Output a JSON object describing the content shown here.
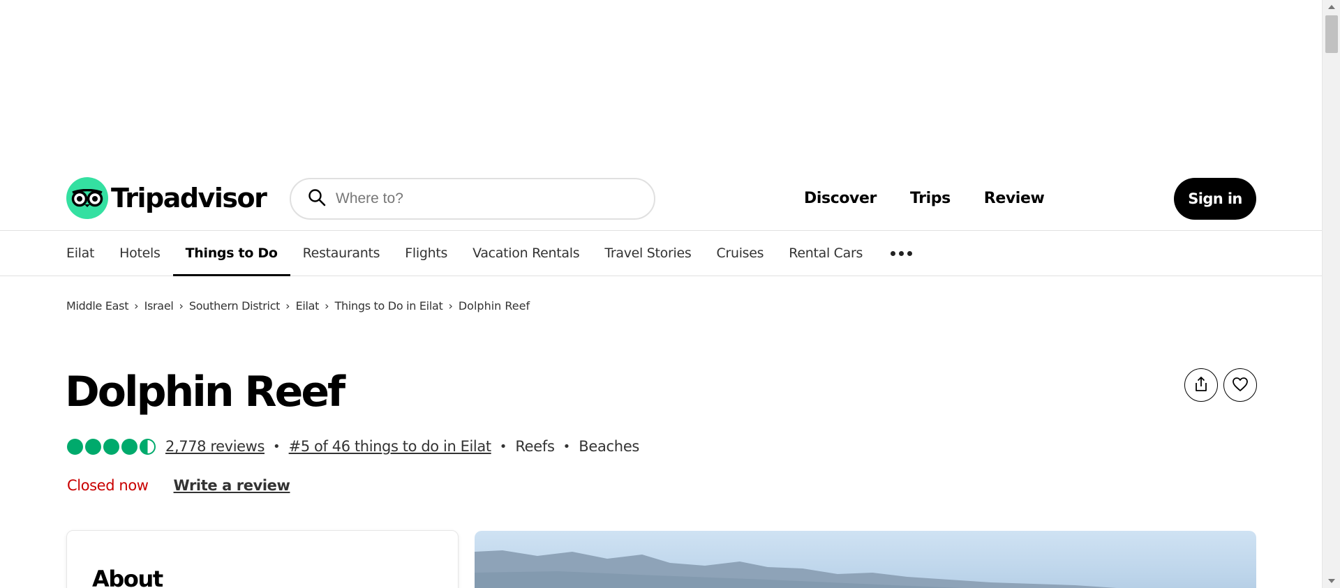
{
  "header": {
    "logo_text": "Tripadvisor",
    "search": {
      "placeholder": "Where to?"
    },
    "nav": [
      "Discover",
      "Trips",
      "Review"
    ],
    "signin_label": "Sign in"
  },
  "subnav": {
    "items": [
      "Eilat",
      "Hotels",
      "Things to Do",
      "Restaurants",
      "Flights",
      "Vacation Rentals",
      "Travel Stories",
      "Cruises",
      "Rental Cars"
    ],
    "active": "Things to Do"
  },
  "breadcrumb": [
    "Middle East",
    "Israel",
    "Southern District",
    "Eilat",
    "Things to Do in Eilat",
    "Dolphin Reef"
  ],
  "attraction": {
    "title": "Dolphin Reef",
    "rating": 4.5,
    "reviews_label": "2,778 reviews",
    "rank_label": "#5 of 46 things to do in Eilat",
    "tags": [
      "Reefs",
      "Beaches"
    ],
    "status": "Closed now",
    "write_review_label": "Write a review"
  },
  "about": {
    "heading": "About"
  },
  "colors": {
    "brand_green": "#34e0a1",
    "rating_green": "#00aa6c",
    "closed_red": "#c90000"
  }
}
